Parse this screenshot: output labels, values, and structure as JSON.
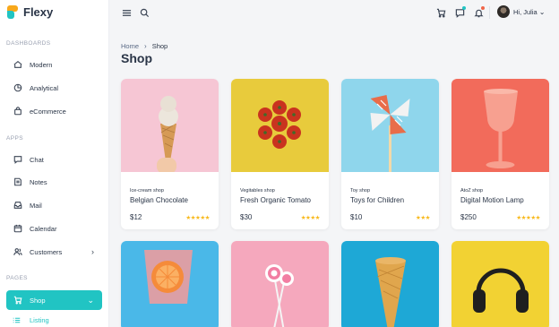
{
  "brand": {
    "name": "Flexy"
  },
  "sidebar": {
    "sections": [
      {
        "title": "DASHBOARDS"
      },
      {
        "title": "APPS"
      },
      {
        "title": "PAGES"
      }
    ],
    "items": [
      {
        "label": "Modern"
      },
      {
        "label": "Analytical"
      },
      {
        "label": "eCommerce"
      },
      {
        "label": "Chat"
      },
      {
        "label": "Notes"
      },
      {
        "label": "Mail"
      },
      {
        "label": "Calendar"
      },
      {
        "label": "Customers"
      },
      {
        "label": "Shop"
      }
    ],
    "sub_active": {
      "label": "Listing"
    }
  },
  "topbar": {
    "greeting": "Hi, Julia",
    "colors": {
      "chat_dot": "#21c4c3",
      "bell_dot": "#f06548"
    }
  },
  "breadcrumb": {
    "home": "Home",
    "current": "Shop"
  },
  "page": {
    "title": "Shop"
  },
  "products": [
    {
      "category": "Ice-cream shop",
      "name": "Belgian Chocolate",
      "price": "$12",
      "rating": 5
    },
    {
      "category": "Vegitables shop",
      "name": "Fresh Organic Tomato",
      "price": "$30",
      "rating": 4
    },
    {
      "category": "Toy shop",
      "name": "Toys for Children",
      "price": "$10",
      "rating": 3
    },
    {
      "category": "AtoZ shop",
      "name": "Digital Motion Lamp",
      "price": "$250",
      "rating": 5
    }
  ],
  "theme": {
    "accent": "#21c4c3",
    "star": "#f8b91b"
  }
}
